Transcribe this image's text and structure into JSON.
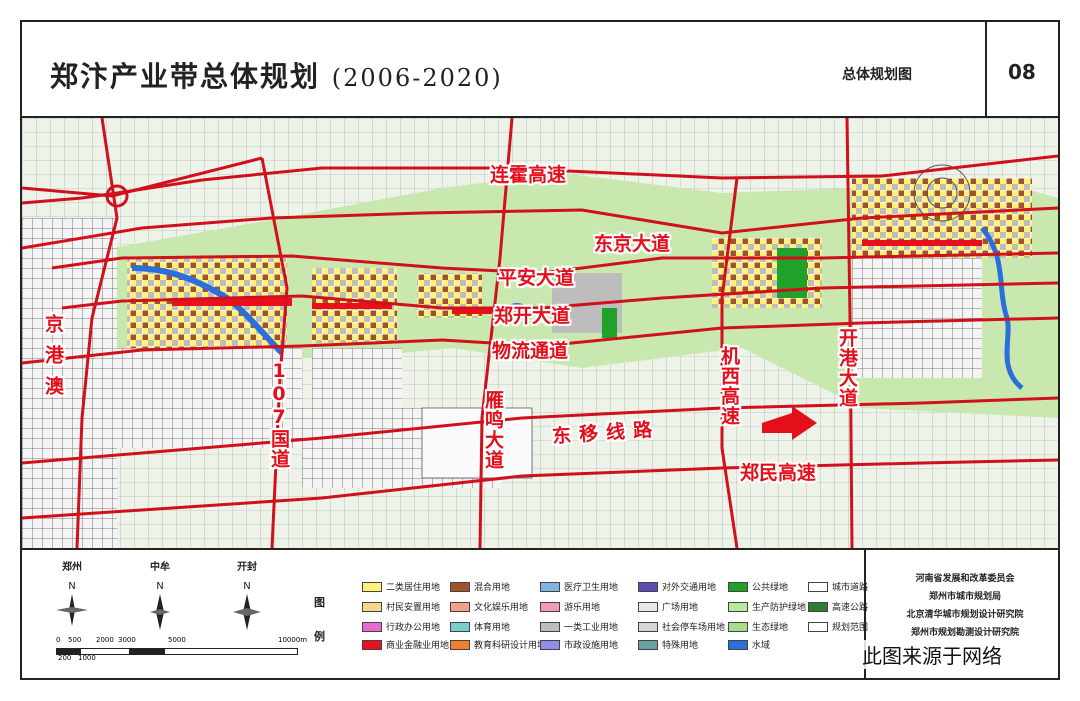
{
  "header": {
    "title": "郑汴产业带总体规划",
    "years": "(2006-2020)",
    "map_name": "总体规划图",
    "page_number": "08"
  },
  "road_labels": {
    "lianhuo": "连霍高速",
    "dongjing": "东京大道",
    "pingan": "平安大道",
    "zhengkai": "郑开大道",
    "wuliu": "物流通道",
    "jingganggao": "京港澳",
    "g107": "107国道",
    "yanming": "雁鸣大道",
    "jixi": "机西高速",
    "kaigang": "开港大道",
    "dongyi": "东移线路",
    "zhengmin": "郑民高速"
  },
  "compass": [
    {
      "city": "郑州",
      "n": "N"
    },
    {
      "city": "中牟",
      "n": "N"
    },
    {
      "city": "开封",
      "n": "N"
    }
  ],
  "scale": {
    "ticks_top": [
      "0",
      "500",
      "2000",
      "3000",
      "5000",
      "10000m"
    ],
    "ticks_bottom": [
      "200",
      "1000"
    ]
  },
  "legend": {
    "heading": "图例",
    "items": [
      {
        "label": "二类居住用地",
        "color": "#fff27a"
      },
      {
        "label": "混合用地",
        "color": "#a0522d"
      },
      {
        "label": "医疗卫生用地",
        "color": "#7fb3e0"
      },
      {
        "label": "对外交通用地",
        "color": "#5a4fb0"
      },
      {
        "label": "公共绿地",
        "color": "#1fa12a"
      },
      {
        "label": "城市道路",
        "color": "#ffffff"
      },
      {
        "label": "村民安置用地",
        "color": "#f7d58a"
      },
      {
        "label": "文化娱乐用地",
        "color": "#f2a08a"
      },
      {
        "label": "游乐用地",
        "color": "#f29ab8"
      },
      {
        "label": "广场用地",
        "color": "#e8e8e8"
      },
      {
        "label": "生产防护绿地",
        "color": "#b7eaa0"
      },
      {
        "label": "高速公路",
        "color": "#2e7d32"
      },
      {
        "label": "行政办公用地",
        "color": "#e86ad0"
      },
      {
        "label": "体育用地",
        "color": "#78d0c8"
      },
      {
        "label": "一类工业用地",
        "color": "#bdbdbd"
      },
      {
        "label": "社会停车场用地",
        "color": "#d6d6d6"
      },
      {
        "label": "生态绿地",
        "color": "#a6dc8c"
      },
      {
        "label": "规划范围",
        "color": "#ffffff"
      },
      {
        "label": "商业金融业用地",
        "color": "#e8101a"
      },
      {
        "label": "教育科研设计用地",
        "color": "#f08030"
      },
      {
        "label": "市政设施用地",
        "color": "#8f8fe8"
      },
      {
        "label": "特殊用地",
        "color": "#6aa0a0"
      },
      {
        "label": "水域",
        "color": "#2a6fdc"
      }
    ]
  },
  "credits": [
    "河南省发展和改革委员会",
    "郑州市城市规划局",
    "北京清华城市规划设计研究院",
    "郑州市规划勘测设计研究院"
  ],
  "watermark": "此图来源于网络",
  "colors": {
    "road": "#d0101a",
    "green_land": "#c9e8b0",
    "farmland": "#eef3ea",
    "water": "#2a6fdc",
    "arrow": "#e3101c"
  }
}
